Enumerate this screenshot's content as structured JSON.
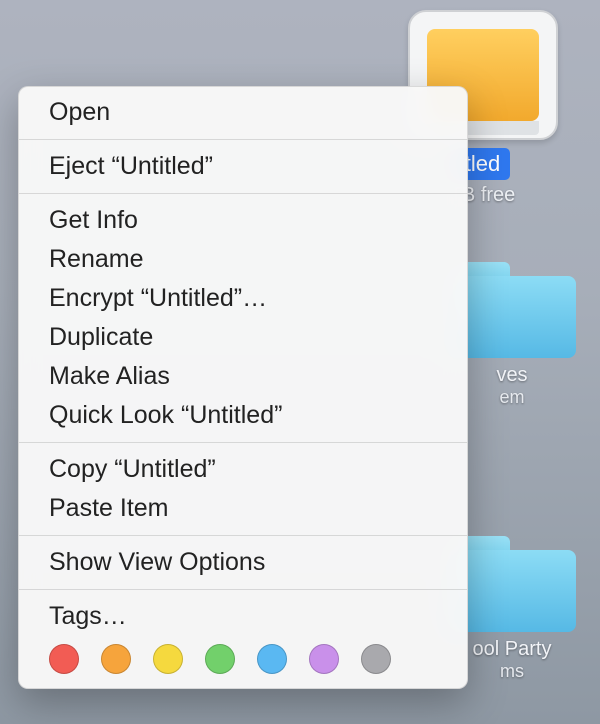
{
  "drive": {
    "name_visible": "tled",
    "sub_visible": "TB free"
  },
  "folder_a": {
    "label_visible": "ves",
    "sub_visible": "em"
  },
  "folder_b": {
    "label_visible": "ool Party",
    "sub_visible": "ms"
  },
  "menu": {
    "open": "Open",
    "eject": "Eject “Untitled”",
    "get_info": "Get Info",
    "rename": "Rename",
    "encrypt": "Encrypt “Untitled”…",
    "duplicate": "Duplicate",
    "make_alias": "Make Alias",
    "quick_look": "Quick Look “Untitled”",
    "copy": "Copy “Untitled”",
    "paste": "Paste Item",
    "view_opts": "Show View Options",
    "tags": "Tags…"
  },
  "tag_colors": {
    "red": "#f25c54",
    "orange": "#f6a43c",
    "yellow": "#f5d93e",
    "green": "#72d06b",
    "blue": "#5ab8f2",
    "purple": "#c990ea",
    "gray": "#a9a9ad"
  }
}
